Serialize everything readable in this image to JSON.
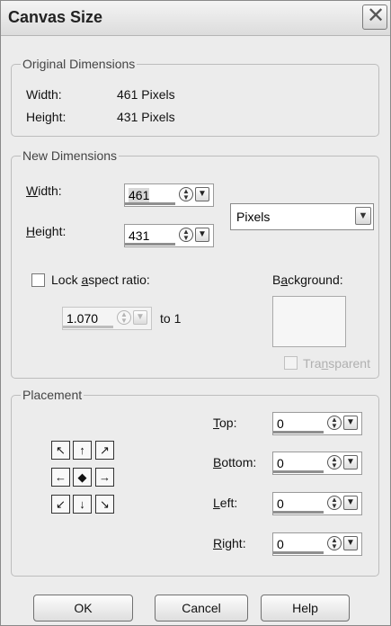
{
  "dialog": {
    "title": "Canvas Size"
  },
  "original": {
    "legend": "Original Dimensions",
    "width_label": "Width:",
    "width_value": "461 Pixels",
    "height_label": "Height:",
    "height_value": "431 Pixels"
  },
  "new": {
    "legend": "New Dimensions",
    "width_label": "Width:",
    "width_value": "461",
    "height_label": "Height:",
    "height_value": "431",
    "units": "Pixels",
    "lock_label": "Lock aspect ratio:",
    "lock_checked": false,
    "ratio_value": "1.070",
    "to_label": "to 1",
    "background_label": "Background:",
    "transparent_label": "Transparent"
  },
  "placement": {
    "legend": "Placement",
    "top_label": "Top:",
    "top_value": "0",
    "bottom_label": "Bottom:",
    "bottom_value": "0",
    "left_label": "Left:",
    "left_value": "0",
    "right_label": "Right:",
    "right_value": "0",
    "arrows": [
      "↖",
      "↑",
      "↗",
      "←",
      "◆",
      "→",
      "↙",
      "↓",
      "↘"
    ]
  },
  "buttons": {
    "ok": "OK",
    "cancel": "Cancel",
    "help": "Help"
  },
  "icons": {
    "close": "close-icon",
    "spin": "spin-updown-icon",
    "dropdown": "chevron-down-icon"
  }
}
